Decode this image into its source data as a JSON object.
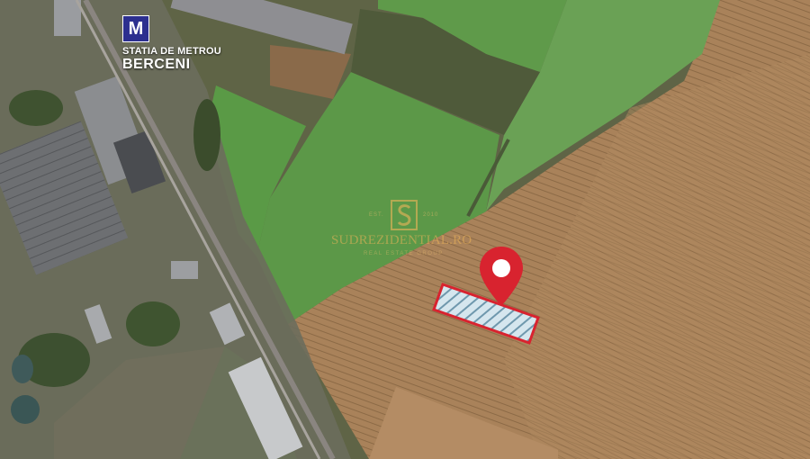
{
  "metro": {
    "icon_letter": "M",
    "line1": "STATIA DE METROU",
    "line2": "BERCENI",
    "badge_color": "#2c2f8f"
  },
  "watermark": {
    "brand": "SUDREZIDENTIAL.RO",
    "tagline": "REAL ESTATE GROUP",
    "est": "EST.",
    "year": "2010",
    "color": "#e6b45a"
  },
  "marker": {
    "icon": "map-pin-icon",
    "color": "#d8232f"
  },
  "plot": {
    "fill": "#b8d8e8",
    "outline": "#d8232f"
  }
}
